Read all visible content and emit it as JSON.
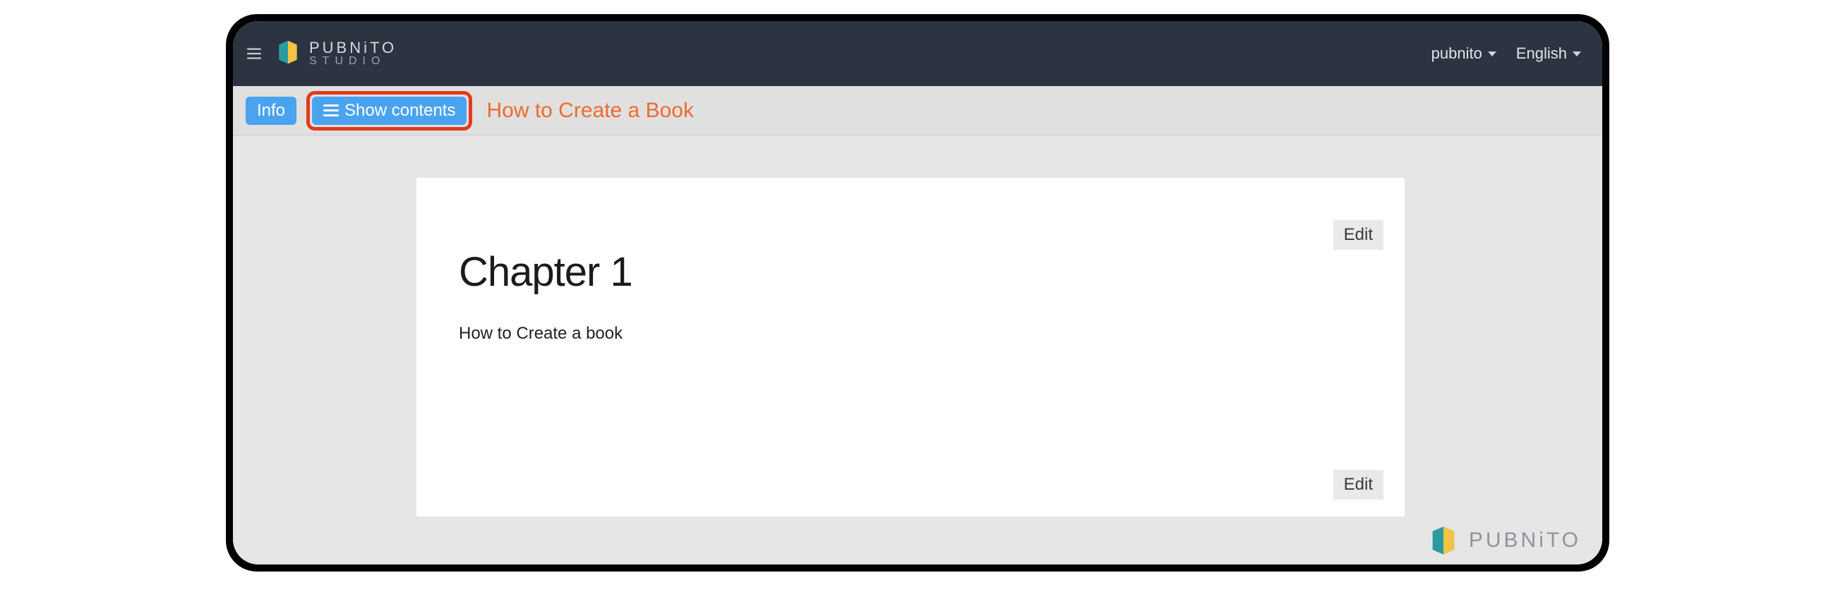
{
  "header": {
    "brand_line1": "PUBNiTO",
    "brand_line2": "STUDIO",
    "user_menu_label": "pubnito",
    "language_menu_label": "English"
  },
  "subbar": {
    "info_label": "Info",
    "show_contents_label": "Show contents",
    "book_title": "How to Create a Book"
  },
  "page": {
    "edit_label": "Edit",
    "chapter_title": "Chapter 1",
    "chapter_body": "How to Create a book"
  },
  "watermark": {
    "brand": "PUBNiTO"
  }
}
